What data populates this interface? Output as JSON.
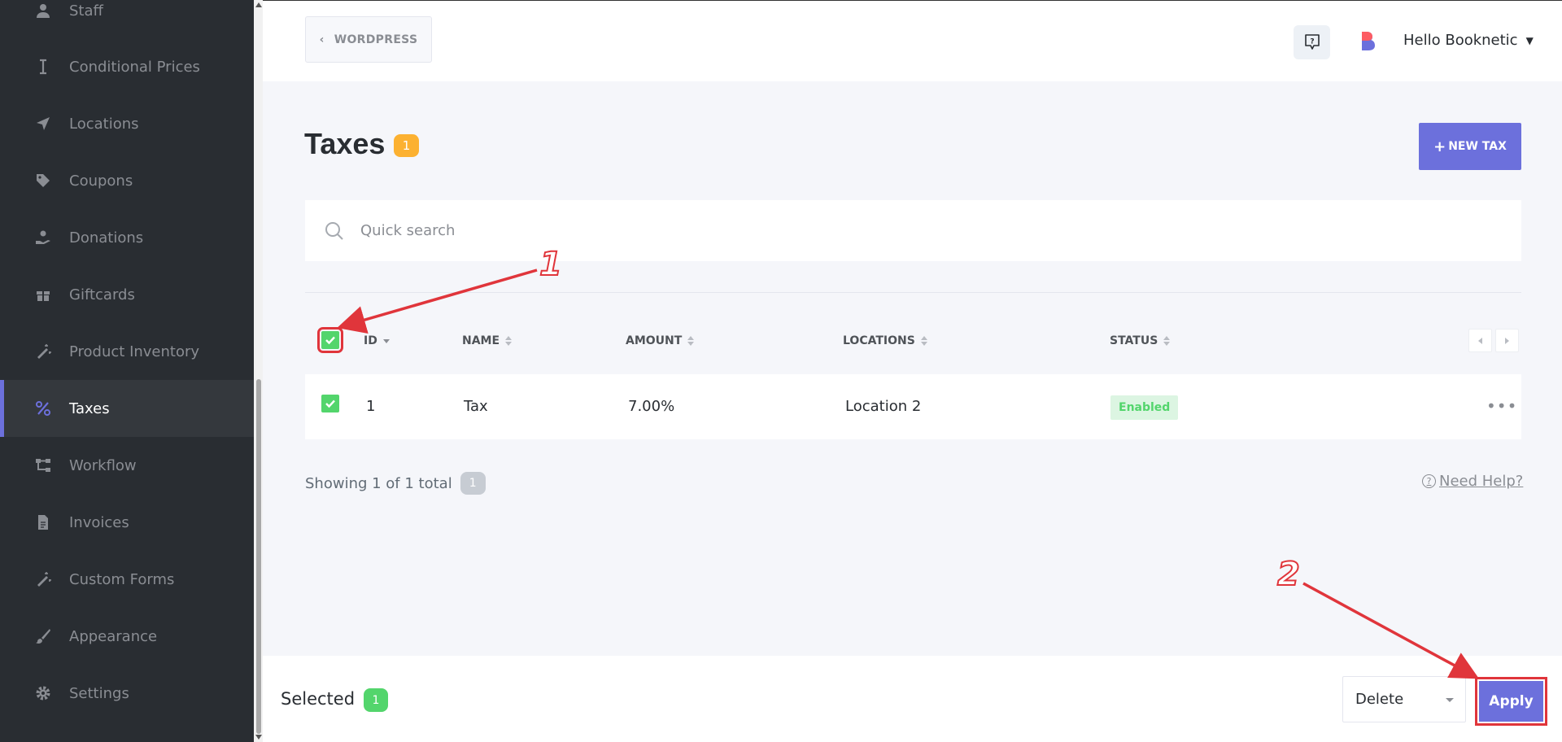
{
  "sidebar": {
    "items": [
      {
        "label": "Staff",
        "icon": "user-icon"
      },
      {
        "label": "Conditional Prices",
        "icon": "text-cursor-icon"
      },
      {
        "label": "Locations",
        "icon": "location-arrow-icon"
      },
      {
        "label": "Coupons",
        "icon": "tag-icon"
      },
      {
        "label": "Donations",
        "icon": "hand-holding-icon"
      },
      {
        "label": "Giftcards",
        "icon": "gift-icon"
      },
      {
        "label": "Product Inventory",
        "icon": "magic-wand-icon"
      },
      {
        "label": "Taxes",
        "icon": "percent-icon",
        "active": true
      },
      {
        "label": "Workflow",
        "icon": "workflow-icon"
      },
      {
        "label": "Invoices",
        "icon": "file-icon"
      },
      {
        "label": "Custom Forms",
        "icon": "magic-wand-icon"
      },
      {
        "label": "Appearance",
        "icon": "brush-icon"
      },
      {
        "label": "Settings",
        "icon": "gear-icon"
      }
    ]
  },
  "header": {
    "back_label": "WORDPRESS",
    "user_greeting": "Hello Booknetic"
  },
  "page": {
    "title": "Taxes",
    "count": "1",
    "new_button": "NEW TAX"
  },
  "search": {
    "placeholder": "Quick search"
  },
  "table": {
    "columns": [
      "ID",
      "NAME",
      "AMOUNT",
      "LOCATIONS",
      "STATUS"
    ],
    "rows": [
      {
        "id": "1",
        "name": "Tax",
        "amount": "7.00%",
        "locations": "Location 2",
        "status": "Enabled",
        "checked": true
      }
    ]
  },
  "footer": {
    "showing": "Showing 1 of 1 total",
    "total": "1",
    "help": "Need Help?"
  },
  "bulk": {
    "selected_label": "Selected",
    "selected_count": "1",
    "action_value": "Delete",
    "apply_label": "Apply"
  },
  "annotations": {
    "step1": "1",
    "step2": "2"
  },
  "colors": {
    "accent": "#6c70dc",
    "success": "#53d56c",
    "warning": "#fcb131",
    "annotation": "#e0353b",
    "sidebar_bg": "#292d32"
  }
}
